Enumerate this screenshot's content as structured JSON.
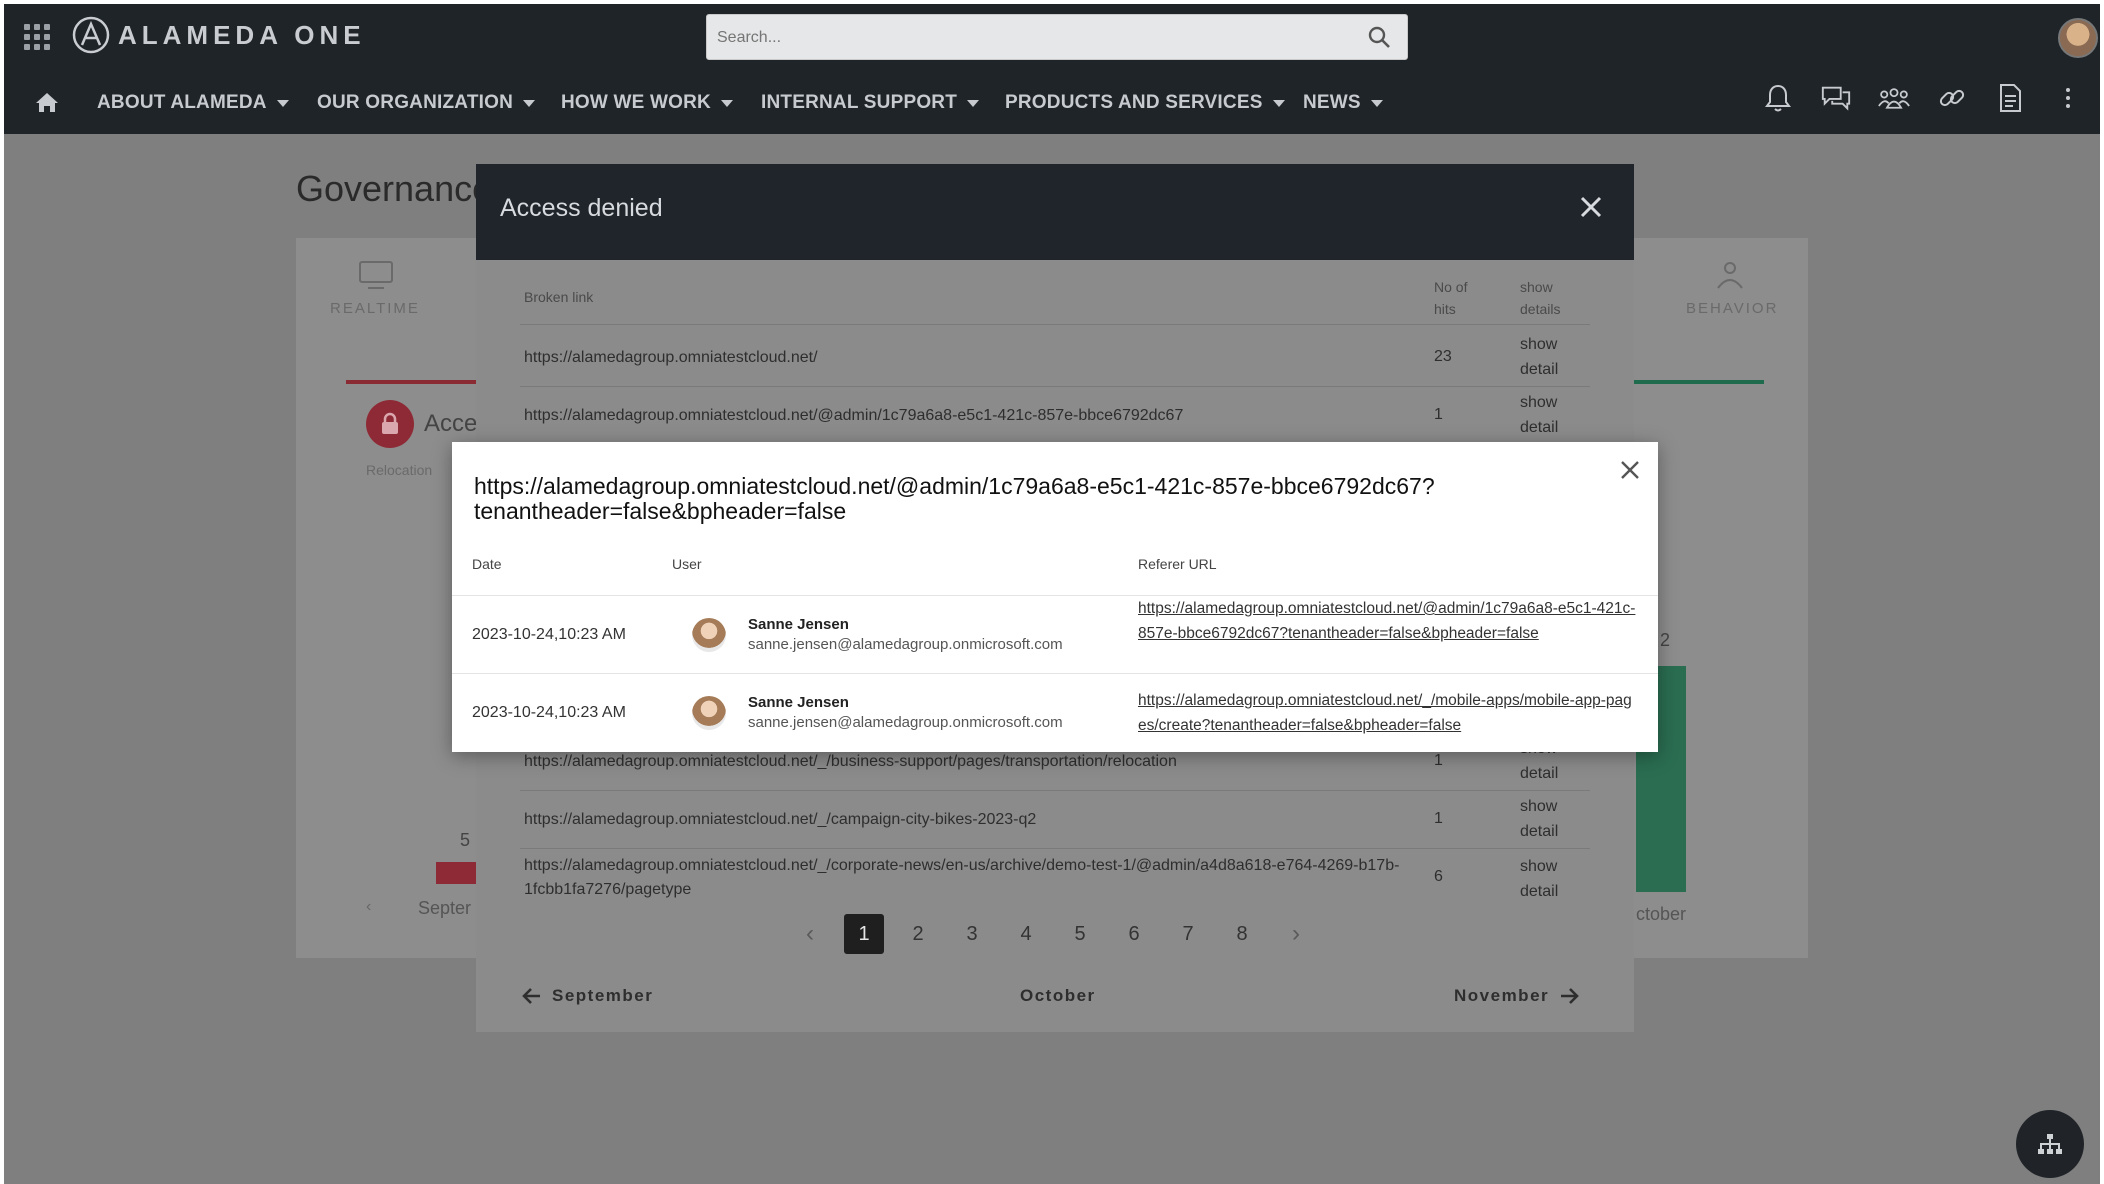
{
  "topbar": {
    "logo_text": "ALAMEDA ONE",
    "search_placeholder": "Search...",
    "nav": [
      {
        "label": "ABOUT ALAMEDA"
      },
      {
        "label": "OUR ORGANIZATION"
      },
      {
        "label": "HOW WE WORK"
      },
      {
        "label": "INTERNAL SUPPORT"
      },
      {
        "label": "PRODUCTS AND SERVICES"
      },
      {
        "label": "NEWS"
      }
    ],
    "tools": [
      "bell-icon",
      "chat-icon",
      "people-icon",
      "link-icon",
      "document-icon",
      "more-vertical-icon"
    ]
  },
  "background": {
    "page_title": "Governance",
    "tab_left_label": "REALTIME",
    "tab_right_label": "BEHAVIOR",
    "card_title_fragment": "Acce",
    "card_sub_fragment": "Relocation",
    "chart_value_left": "5",
    "chart_value_right": "2",
    "chart_month_left": "Septer",
    "chart_month_right": "ctober"
  },
  "access_modal": {
    "title": "Access denied",
    "headers": {
      "link": "Broken link",
      "hits": "No of hits",
      "details": "show details"
    },
    "rows": [
      {
        "link": "https://alamedagroup.omniatestcloud.net/",
        "hits": "23",
        "details": "show detail"
      },
      {
        "link": "https://alamedagroup.omniatestcloud.net/@admin/1c79a6a8-e5c1-421c-857e-bbce6792dc67",
        "hits": "1",
        "details": "show detail"
      },
      {
        "link": "https://alamedagroup.omniatestcloud.net/_/business-support/pages/transportation/relocation",
        "hits": "1",
        "details": "show detail"
      },
      {
        "link": "https://alamedagroup.omniatestcloud.net/_/campaign-city-bikes-2023-q2",
        "hits": "1",
        "details": "show detail"
      },
      {
        "link": "https://alamedagroup.omniatestcloud.net/_/corporate-news/en-us/archive/demo-test-1/@admin/a4d8a618-e764-4269-b17b-1fcbb1fa7276/pagetype",
        "hits": "6",
        "details": "show detail"
      }
    ],
    "pagination": {
      "pages": [
        "1",
        "2",
        "3",
        "4",
        "5",
        "6",
        "7",
        "8"
      ],
      "current": "1",
      "prev": "‹",
      "next": "›"
    },
    "month_nav": {
      "prev": "September",
      "current": "October",
      "next": "November"
    }
  },
  "details_modal": {
    "title": "https://alamedagroup.omniatestcloud.net/@admin/1c79a6a8-e5c1-421c-857e-bbce6792dc67?tenantheader=false&bpheader=false",
    "headers": {
      "date": "Date",
      "user": "User",
      "referer": "Referer URL"
    },
    "rows": [
      {
        "date": "2023-10-24,10:23 AM",
        "name": "Sanne Jensen",
        "email": "sanne.jensen@alamedagroup.onmicrosoft.com",
        "referer": "https://alamedagroup.omniatestcloud.net/@admin/1c79a6a8-e5c1-421c-857e-bbce6792dc67?tenantheader=false&bpheader=false"
      },
      {
        "date": "2023-10-24,10:23 AM",
        "name": "Sanne Jensen",
        "email": "sanne.jensen@alamedagroup.onmicrosoft.com",
        "referer": "https://alamedagroup.omniatestcloud.net/_/mobile-apps/mobile-app-pages/create?tenantheader=false&bpheader=false"
      }
    ]
  }
}
